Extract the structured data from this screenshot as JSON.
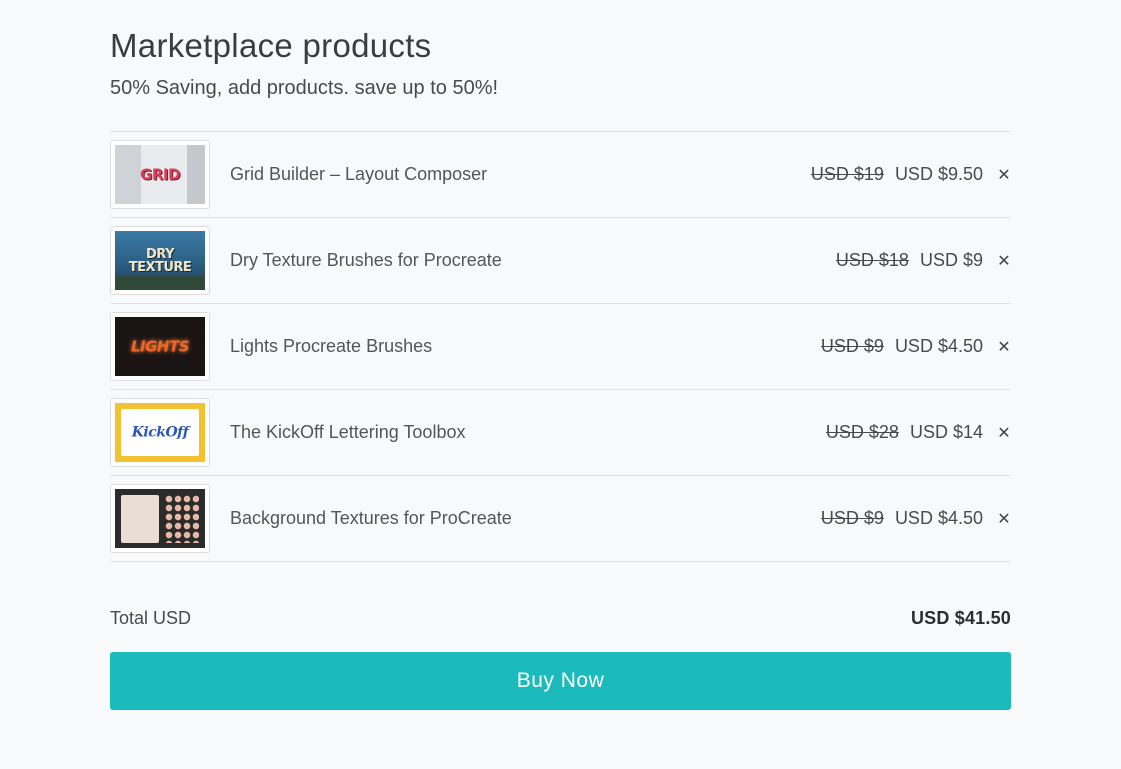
{
  "header": {
    "title": "Marketplace products",
    "subtitle": "50% Saving, add products. save up to 50%!"
  },
  "products": [
    {
      "name": "Grid Builder – Layout Composer",
      "old_price": "USD $19",
      "new_price": "USD $9.50",
      "thumb_label": "GRID",
      "thumb_bg": "#e9ecef",
      "thumb_fg": "#d6415a"
    },
    {
      "name": "Dry Texture Brushes for Procreate",
      "old_price": "USD $18",
      "new_price": "USD $9",
      "thumb_label": "DRY TEXTURE",
      "thumb_bg": "#2c5f84",
      "thumb_fg": "#f3e6c8"
    },
    {
      "name": "Lights Procreate Brushes",
      "old_price": "USD $9",
      "new_price": "USD $4.50",
      "thumb_label": "LIGHTS",
      "thumb_bg": "#1a1414",
      "thumb_fg": "#f0642a"
    },
    {
      "name": "The KickOff Lettering Toolbox",
      "old_price": "USD $28",
      "new_price": "USD $14",
      "thumb_label": "KickOff",
      "thumb_bg": "#f2c230",
      "thumb_fg": "#2a56b8"
    },
    {
      "name": "Background Textures for ProCreate",
      "old_price": "USD $9",
      "new_price": "USD $4.50",
      "thumb_label": "",
      "thumb_bg": "#2b2b2b",
      "thumb_fg": "#e6b8a6"
    }
  ],
  "remove_icon": "close-icon",
  "remove_glyph": "✕",
  "total": {
    "label": "Total USD",
    "value": "USD $41.50"
  },
  "buy_button": {
    "label": "Buy Now",
    "color": "#1bbbbb"
  }
}
